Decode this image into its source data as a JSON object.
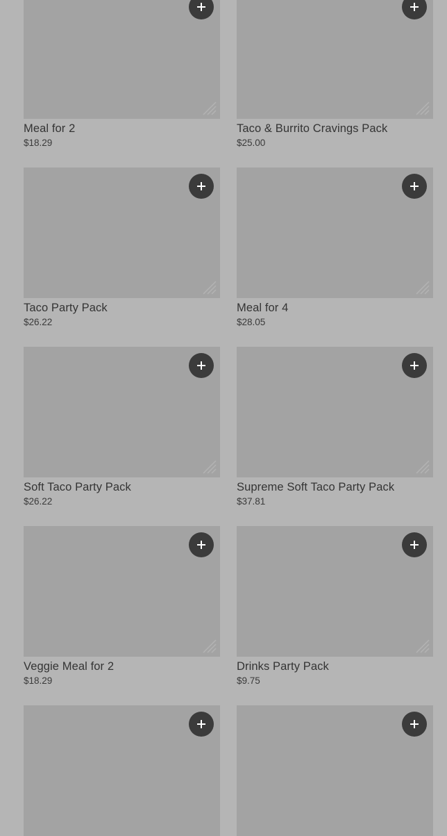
{
  "products": [
    {
      "name": "Meal for 2",
      "price": "$18.29",
      "add_icon": "plus-icon"
    },
    {
      "name": "Taco & Burrito Cravings Pack",
      "price": "$25.00",
      "add_icon": "plus-icon"
    },
    {
      "name": "Taco Party Pack",
      "price": "$26.22",
      "add_icon": "plus-icon"
    },
    {
      "name": "Meal for 4",
      "price": "$28.05",
      "add_icon": "plus-icon"
    },
    {
      "name": "Soft Taco Party Pack",
      "price": "$26.22",
      "add_icon": "plus-icon"
    },
    {
      "name": "Supreme Soft Taco Party Pack",
      "price": "$37.81",
      "add_icon": "plus-icon"
    },
    {
      "name": "Veggie Meal for 2",
      "price": "$18.29",
      "add_icon": "plus-icon"
    },
    {
      "name": "Drinks Party Pack",
      "price": "$9.75",
      "add_icon": "plus-icon"
    },
    {
      "name": "",
      "price": "",
      "add_icon": "plus-icon"
    },
    {
      "name": "",
      "price": "",
      "add_icon": "plus-icon"
    }
  ],
  "colors": {
    "background": "#b5b5b5",
    "image_placeholder": "#a3a3a3",
    "add_button": "#3b3b3b",
    "text": "#343434"
  }
}
